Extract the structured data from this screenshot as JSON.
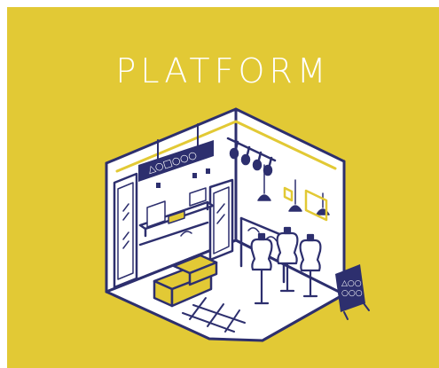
{
  "colors": {
    "background": "#e2c935",
    "navy": "#2d2f6e",
    "white": "#ffffff",
    "yellow": "#e2c935"
  },
  "header": {
    "title": "PLATFORM"
  },
  "illustration": {
    "store_sign_logo": "△○□○○○",
    "sandwich_board_logo": "△○○\n○○○"
  }
}
